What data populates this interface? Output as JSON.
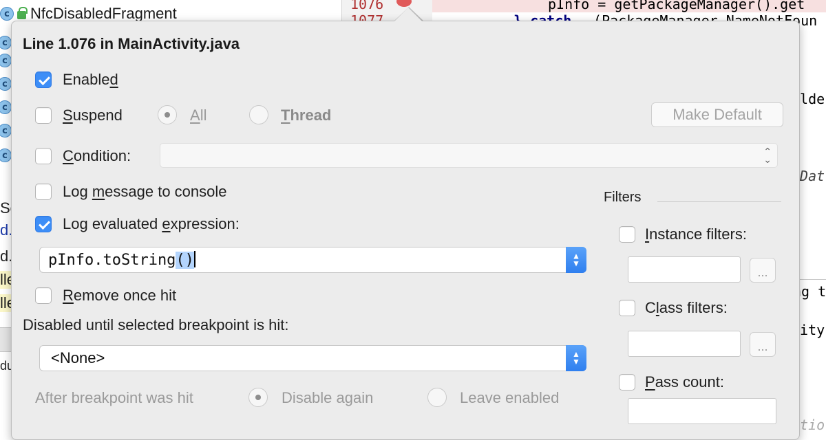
{
  "project_tree": {
    "top_item": {
      "label": "NfcDisabledFragment",
      "icon": "class-icon",
      "secondary_icon": "lock-icon"
    },
    "fragments": [
      "Sc",
      "d.",
      "d.",
      "lle",
      "lle",
      "du"
    ]
  },
  "gutter": {
    "lines": [
      "1076",
      "1077"
    ]
  },
  "editor": {
    "line1": "pInfo = getPackageManager().get",
    "line2_kw": "} catch",
    "line2_rest": " (PackageManager.NameNotFoun",
    "frag_ilde": "ilde",
    "frag_data": "tDat",
    "frag_ngt": "ng t",
    "frag_vity": "vity",
    "frag_atio": "atio"
  },
  "popup": {
    "title": "Line 1.076 in MainActivity.java",
    "enabled": {
      "pre": "Enable",
      "u": "d",
      "post": "",
      "checked": true
    },
    "suspend": {
      "pre": "",
      "u": "S",
      "post": "uspend",
      "checked": false
    },
    "suspend_all": {
      "pre": "",
      "u": "A",
      "post": "ll",
      "selected": true
    },
    "suspend_thread": {
      "pre": "",
      "u": "T",
      "post": "hread",
      "selected": false
    },
    "make_default_label": "Make Default",
    "condition": {
      "pre": "",
      "u": "C",
      "post": "ondition:",
      "checked": false,
      "value": ""
    },
    "log_message": {
      "pre": "Log ",
      "u": "m",
      "post": "essage to console",
      "checked": false
    },
    "log_expression": {
      "pre": "Log evaluated ",
      "u": "e",
      "post": "xpression:",
      "checked": true
    },
    "expression": {
      "before": "pInfo.toString",
      "selected": "()"
    },
    "remove_once_hit": {
      "pre": "",
      "u": "R",
      "post": "emove once hit",
      "checked": false
    },
    "disabled_until_label": "Disabled until selected breakpoint is hit:",
    "disabled_until_value": "<None>",
    "after_hit_label": "After breakpoint was hit",
    "disable_again": {
      "label": "Disable again",
      "selected": true
    },
    "leave_enabled": {
      "label": "Leave enabled",
      "selected": false
    },
    "filters": {
      "heading": "Filters",
      "instance": {
        "pre": "",
        "u": "I",
        "post": "nstance filters:",
        "checked": false,
        "value": ""
      },
      "class": {
        "pre": "C",
        "u": "l",
        "post": "ass filters:",
        "checked": false,
        "value": ""
      },
      "pass_count": {
        "pre": "",
        "u": "P",
        "post": "ass count:",
        "checked": false,
        "value": ""
      },
      "dots_label": "..."
    }
  },
  "colors": {
    "accent": "#3d8ef7",
    "breakpoint": "#e05a5a"
  }
}
